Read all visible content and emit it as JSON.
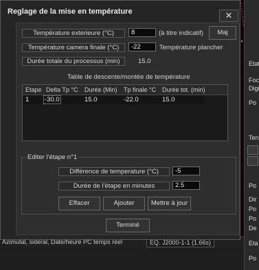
{
  "background": {
    "status_left": "Azimutal, sideral, Date/heure PC temps reel",
    "status_right": "EQ. J2000-1-1 (1.66s)",
    "right_panel_labels": [
      "Etat",
      "Focu",
      "Digi",
      "Po",
      "Ten",
      "C",
      "C",
      "Po",
      "Dir",
      "Po",
      "Po",
      "De",
      "Eta",
      "Po"
    ]
  },
  "dialog": {
    "title": "Reglage de la mise en température",
    "close_glyph": "✕",
    "ext_temp": {
      "label": "Température exterieure (°C)",
      "value": "8",
      "note": "(à titre indicatif)"
    },
    "maj_button": "Maj",
    "camera_temp": {
      "label": "Température camera finale (°C)",
      "value": "-22",
      "note": "Température plancher"
    },
    "duration": {
      "label": "Durée totale du processus (min)",
      "value": "15.0"
    },
    "table": {
      "caption": "Table de descente/montée de température",
      "columns": [
        "Etape",
        "Delta Tp °C",
        "Durée (Min)",
        "Tp finale °C",
        "Durée tot. (min)"
      ],
      "rows": [
        {
          "etape": "1",
          "delta": "-30.0",
          "duree": "15.0",
          "tp_finale": "-22.0",
          "duree_tot": "15.0"
        }
      ]
    },
    "edit": {
      "title": "Editer l'étape n°1",
      "diff_label": "Différence de temperature (°C)",
      "diff_value": "-5",
      "dur_label": "Durée de l'étape en minutes",
      "dur_value": "2.5",
      "effacer": "Effacer",
      "ajouter": "Ajouter",
      "mettre_a_jour": "Mettre à jour"
    },
    "termine": "Terminé"
  }
}
